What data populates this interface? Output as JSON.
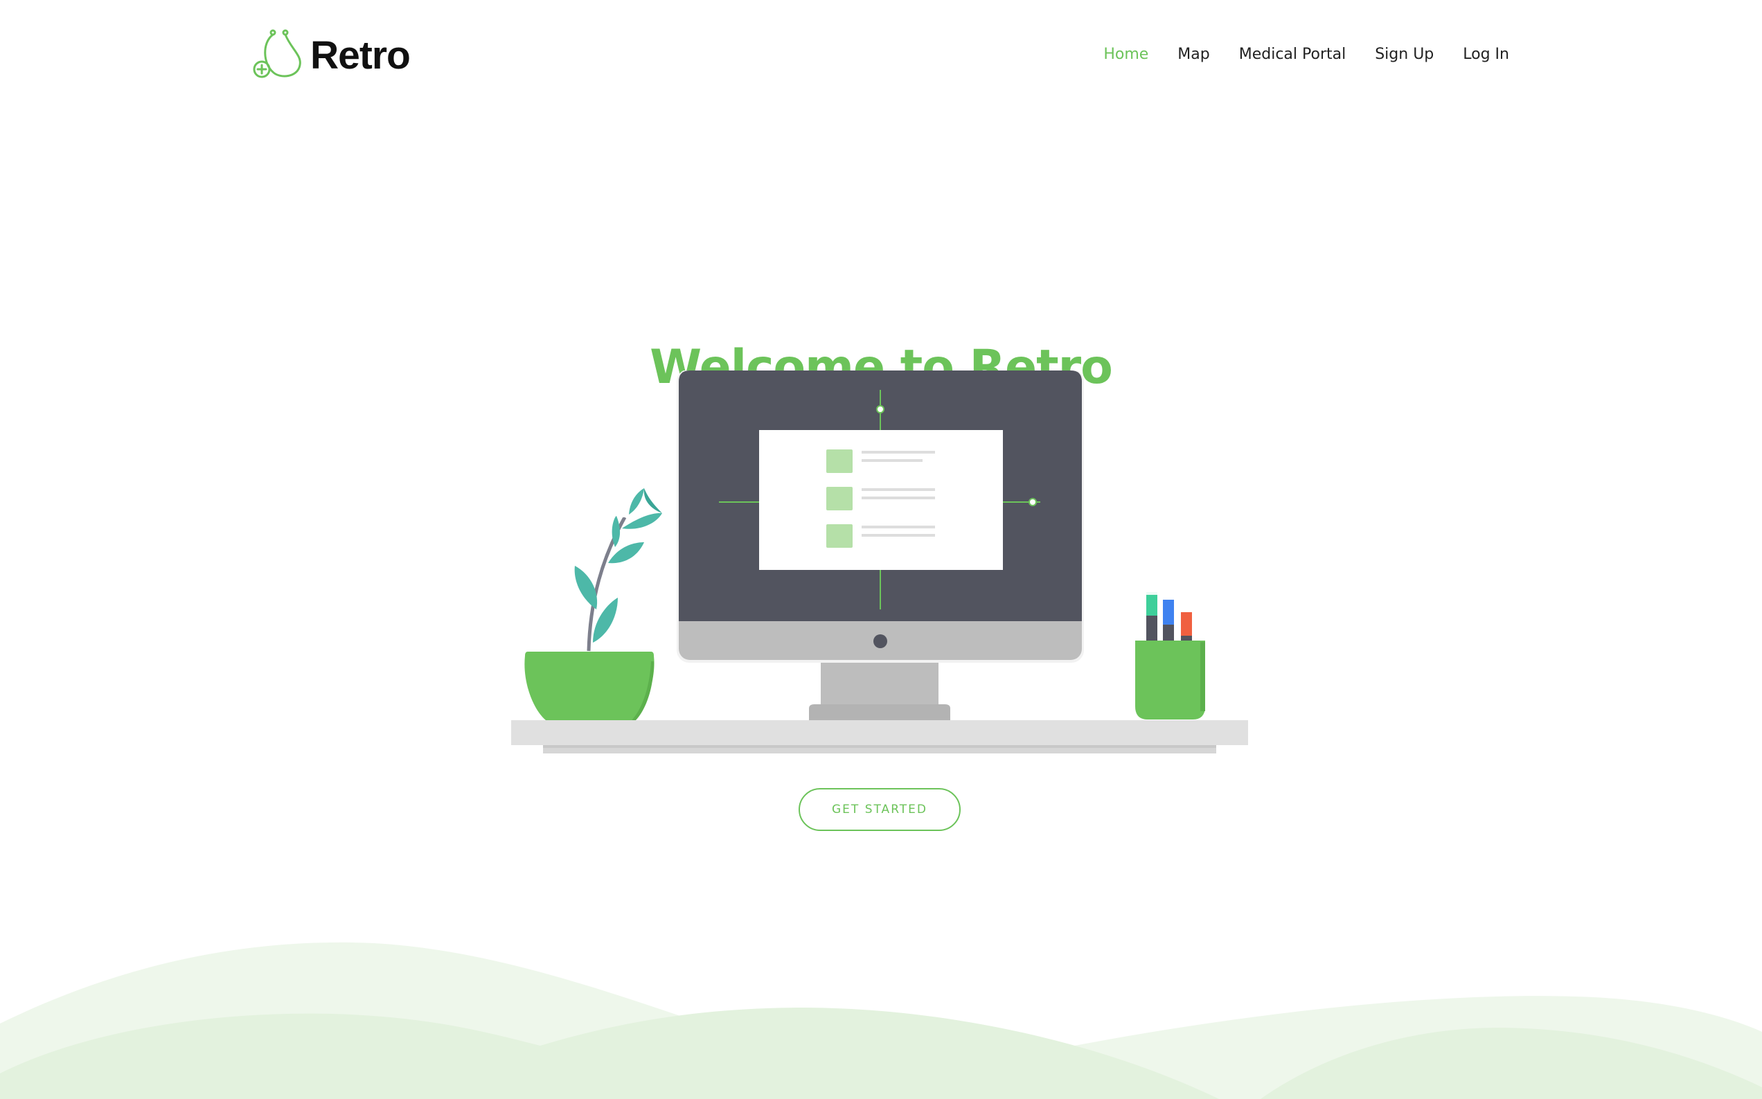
{
  "brand": {
    "name": "Retro",
    "accent_color": "#6cc35a",
    "logo_icon": "stethoscope-icon"
  },
  "nav": {
    "items": [
      {
        "label": "Home",
        "active": true
      },
      {
        "label": "Map",
        "active": false
      },
      {
        "label": "Medical Portal",
        "active": false
      },
      {
        "label": "Sign Up",
        "active": false
      },
      {
        "label": "Log In",
        "active": false
      }
    ]
  },
  "hero": {
    "title": "Welcome to Retro",
    "cta_label": "GET STARTED"
  },
  "illustration": {
    "subject": "desk-with-computer-plant-pencil-cup",
    "colors": {
      "monitor_screen": "#52545f",
      "monitor_bezel": "#bdbdbd",
      "desk": "#e0e0e0",
      "plant_pot": "#6cc35a",
      "plant_leaves": "#4db8a8",
      "pen_green": "#3ecf9a",
      "pen_blue": "#3f82f0",
      "pen_red": "#f06040",
      "list_square": "#b5e0a8"
    }
  },
  "background": {
    "wave_light": "#eef7eb",
    "wave_mid": "#e3f2de"
  }
}
